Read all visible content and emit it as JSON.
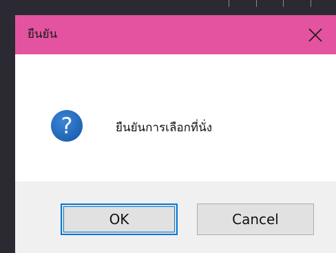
{
  "dialog": {
    "title": "ยืนยัน",
    "close_icon": "close-icon",
    "icon": "question-icon",
    "message": "ยืนยันการเลือกที่นั่ง",
    "buttons": {
      "ok_label": "OK",
      "cancel_label": "Cancel"
    }
  },
  "colors": {
    "titlebar": "#e3539f",
    "question_icon_fill": "#1c5fb0",
    "focus_border": "#0078d7",
    "footer_bg": "#f0f0f0"
  }
}
